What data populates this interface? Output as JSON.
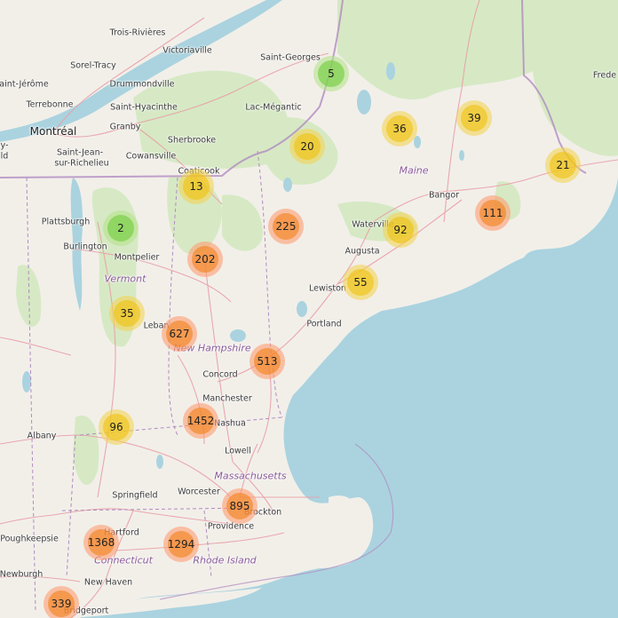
{
  "colors": {
    "land": "#f2efe9",
    "water": "#aad3df",
    "forest": "#d6e9c4",
    "border": "#b08bc0",
    "road": "#e9a0a8",
    "cluster_small": "#6ecc39",
    "cluster_medium": "#f0c20c",
    "cluster_large": "#f18017"
  },
  "labels": {
    "trois_rivieres": "Trois-Rivières",
    "victoriaville": "Victoriaville",
    "saint_georges": "Saint-Georges",
    "sorel_tracy": "Sorel-Tracy",
    "saint_jerome": "aint-Jérôme",
    "drummondville": "Drummondville",
    "fredericton": "Frede",
    "terrebonne": "Terrebonne",
    "saint_hyacinthe": "Saint-Hyacinthe",
    "lac_megantic": "Lac-Mégantic",
    "granby": "Granby",
    "montreal": "Montréal",
    "sherbrooke": "Sherbrooke",
    "saint_jean": "Saint-Jean-",
    "sur_richelieu": "sur-Richelieu",
    "cowansville": "Cowansville",
    "coaticook": "Coaticook",
    "y_fragment": "y-",
    "ld_fragment": "ld",
    "maine": "Maine",
    "bangor": "Bangor",
    "plattsburgh": "Plattsburgh",
    "burlington": "Burlington",
    "waterville": "Waterville",
    "montpelier": "Montpelier",
    "augusta": "Augusta",
    "vermont": "Vermont",
    "lewiston": "Lewiston",
    "lebanon": "Leban",
    "portland": "Portland",
    "new_hampshire": "New Hampshire",
    "concord": "Concord",
    "manchester": "Manchester",
    "nashua": "Nashua",
    "albany": "Albany",
    "lowell": "Lowell",
    "massachusetts": "Massachusetts",
    "springfield": "Springfield",
    "worcester": "Worcester",
    "brockton": "Brockton",
    "hartford": "Hartford",
    "poughkeepsie": "Poughkeepsie",
    "providence": "Providence",
    "connecticut": "Connecticut",
    "rhode_island": "Rhode Island",
    "newburgh": "Newburgh",
    "new_haven": "New Haven",
    "bridgeport": "Bridgeport"
  },
  "clusters": [
    {
      "count": "5",
      "size": "small"
    },
    {
      "count": "36",
      "size": "medium"
    },
    {
      "count": "39",
      "size": "medium"
    },
    {
      "count": "20",
      "size": "medium"
    },
    {
      "count": "21",
      "size": "medium"
    },
    {
      "count": "13",
      "size": "medium"
    },
    {
      "count": "2",
      "size": "small"
    },
    {
      "count": "225",
      "size": "large"
    },
    {
      "count": "111",
      "size": "large"
    },
    {
      "count": "92",
      "size": "medium"
    },
    {
      "count": "202",
      "size": "large"
    },
    {
      "count": "55",
      "size": "medium"
    },
    {
      "count": "35",
      "size": "medium"
    },
    {
      "count": "627",
      "size": "large"
    },
    {
      "count": "513",
      "size": "large"
    },
    {
      "count": "1452",
      "size": "large"
    },
    {
      "count": "96",
      "size": "medium"
    },
    {
      "count": "895",
      "size": "large"
    },
    {
      "count": "1368",
      "size": "large"
    },
    {
      "count": "1294",
      "size": "large"
    },
    {
      "count": "339",
      "size": "large"
    }
  ]
}
